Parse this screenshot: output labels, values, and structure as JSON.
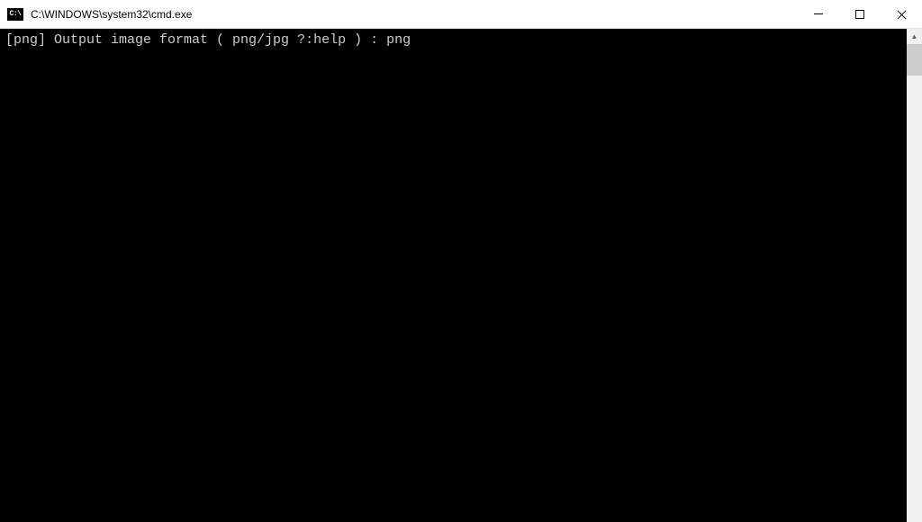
{
  "window": {
    "title": "C:\\WINDOWS\\system32\\cmd.exe",
    "icon_label": "C:\\"
  },
  "terminal": {
    "prompt_default": "[png]",
    "prompt_text": " Output image format ( png/jpg ?:help ) : ",
    "input_value": "png"
  }
}
